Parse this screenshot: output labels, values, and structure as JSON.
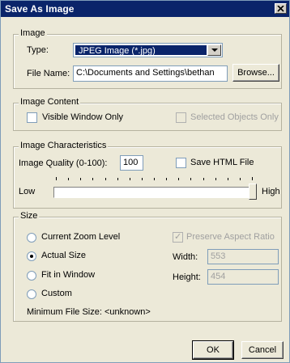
{
  "window": {
    "title": "Save As Image",
    "close_glyph": "✕"
  },
  "image_group": {
    "legend": "Image",
    "type_label": "Type:",
    "type_value": "JPEG Image (*.jpg)",
    "filename_label": "File Name:",
    "filename_value": "C:\\Documents and Settings\\bethan",
    "browse_label": "Browse..."
  },
  "content_group": {
    "legend": "Image Content",
    "visible_window_only": "Visible Window Only",
    "selected_objects_only": "Selected Objects Only"
  },
  "characteristics_group": {
    "legend": "Image Characteristics",
    "quality_label": "Image Quality (0-100):",
    "quality_value": "100",
    "save_html_label": "Save HTML File",
    "low_label": "Low",
    "high_label": "High",
    "slider_level": 1.0
  },
  "size_group": {
    "legend": "Size",
    "options": [
      {
        "label": "Current Zoom Level",
        "selected": false
      },
      {
        "label": "Actual Size",
        "selected": true
      },
      {
        "label": "Fit in Window",
        "selected": false
      },
      {
        "label": "Custom",
        "selected": false
      }
    ],
    "preserve_aspect_label": "Preserve Aspect Ratio",
    "preserve_aspect_checked": true,
    "width_label": "Width:",
    "width_value": "553",
    "height_label": "Height:",
    "height_value": "454",
    "min_file_size": "Minimum File Size:  <unknown>"
  },
  "footer": {
    "ok_label": "OK",
    "cancel_label": "Cancel"
  },
  "colors": {
    "titlebar": "#0a246a",
    "dialog_bg": "#ece9d8",
    "selection": "#0a246a"
  }
}
